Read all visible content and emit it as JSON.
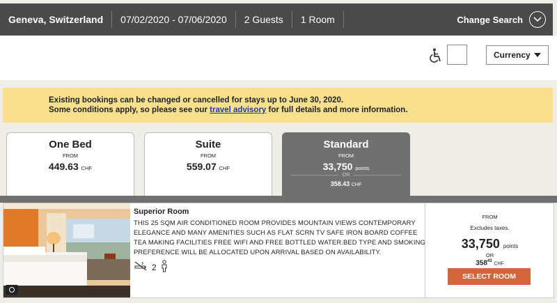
{
  "search": {
    "location": "Geneva, Switzerland",
    "dates": "07/02/2020 - 07/06/2020",
    "guests": "2 Guests",
    "rooms": "1 Room",
    "change_label": "Change Search"
  },
  "toolbar": {
    "currency_label": "Currency",
    "accessibility_icon": "wheelchair-icon"
  },
  "notice": {
    "line1_prefix": "Existing bookings can be changed or cancelled for stays up to ",
    "line1_date": "June 30, 2020.",
    "line2_prefix": "Some conditions apply, so please see our ",
    "link_text": "travel advisory",
    "line2_suffix": " for full details and more information."
  },
  "tabs": [
    {
      "name": "One Bed",
      "from": "FROM",
      "price": "449.63",
      "unit": "CHF",
      "active": false
    },
    {
      "name": "Suite",
      "from": "FROM",
      "price": "559.07",
      "unit": "CHF",
      "active": false
    },
    {
      "name": "Standard",
      "from": "FROM",
      "price": "33,750",
      "unit": "points",
      "or": "OR",
      "alt_price": "358.43",
      "alt_unit": "CHF",
      "active": true
    }
  ],
  "room": {
    "title": "Superior Room",
    "description": "THIS 25 SQM AIR CONDITIONED ROOM PROVIDES MOUNTAIN VIEWS CONTEMPORARY ELEGANCE AND MANY AMENITIES SUCH AS FLAT SCRN TV SAFE IRON BOARD COFFEE TEA MAKING FACILITIES FREE WIFI AND FREE BOTTLED WATER.BED TYPE AND SMOKING PREFERENCE WILL BE ALLOCATED UPON ARRIVAL BASED ON AVAILABILITY.",
    "occupancy": "2",
    "price_from": "FROM",
    "tax_note": "Excludes taxes.",
    "points": "33,750",
    "points_unit": "points",
    "or": "OR",
    "cash_int": "358",
    "cash_dec": "43",
    "cash_unit": "CHF",
    "select_label": "SELECT ROOM"
  },
  "colors": {
    "header_bg": "#4a4a4a",
    "notice_bg": "#f9e08f",
    "active_tab": "#707070",
    "select_button": "#d4643b",
    "link": "#1f3da0"
  }
}
